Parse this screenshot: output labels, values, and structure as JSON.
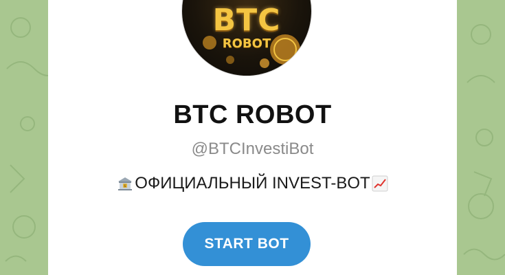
{
  "colors": {
    "background": "#a9c790",
    "card": "#ffffff",
    "button": "#3390d6",
    "username": "#8a8a8a",
    "avatar_gold": "#f4c542"
  },
  "avatar": {
    "title": "BTC",
    "subtitle": "ROBOT"
  },
  "bot": {
    "name": "BTC ROBOT",
    "username": "@BTCInvestiBot",
    "description": {
      "leading_icon": "bank-emoji",
      "text": "ОФИЦИАЛЬНЫЙ INVEST-BOT",
      "trailing_icon": "chart-increasing-emoji"
    }
  },
  "actions": {
    "start_label": "START BOT"
  }
}
